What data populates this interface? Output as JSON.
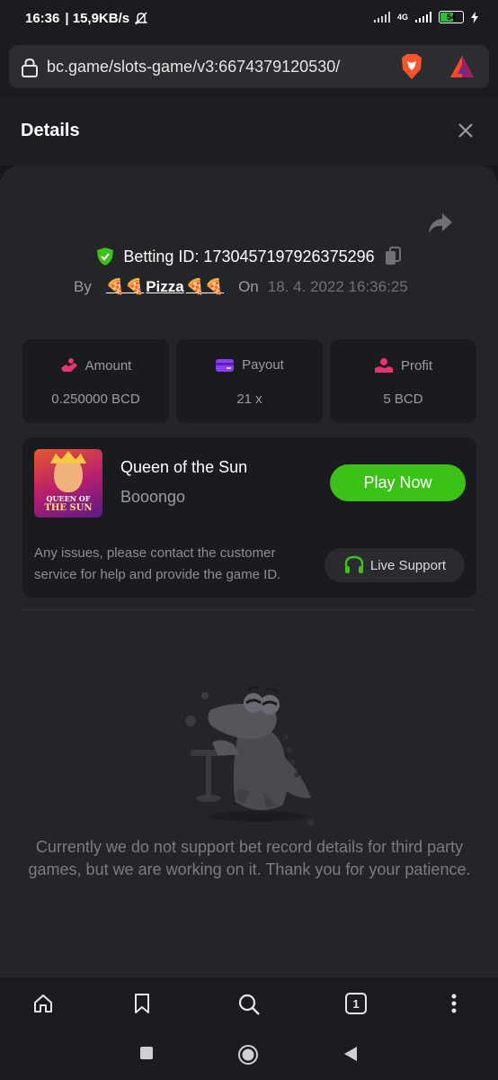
{
  "status_bar": {
    "time": "16:36",
    "speed": "| 15,9KB/s",
    "network": "4G",
    "battery": "54"
  },
  "browser": {
    "url": "bc.game/slots-game/v3:6674379120530/",
    "tab_count": "1"
  },
  "modal": {
    "title": "Details",
    "betting_id_label": "Betting ID: 1730457197926375296",
    "by_label": "By",
    "user_name": "Pizza",
    "user_emoji_left": "🍕🍕",
    "user_emoji_right": "🍕🍕",
    "on_label": "On",
    "date": "18. 4. 2022 16:36:25",
    "stats": [
      {
        "label": "Amount",
        "value": "0.250000 BCD",
        "icon": "amount-icon",
        "color": "#e8356d"
      },
      {
        "label": "Payout",
        "value": "21 x",
        "icon": "card-icon",
        "color": "#8b3ff2"
      },
      {
        "label": "Profit",
        "value": "5 BCD",
        "icon": "profit-icon",
        "color": "#e8356d"
      }
    ],
    "game": {
      "name": "Queen of the Sun",
      "provider": "Booongo",
      "thumb_line1": "QUEEN OF",
      "thumb_line2": "THE SUN",
      "play_label": "Play Now"
    },
    "issues_text": "Any issues, please contact the customer service for help and provide the game ID.",
    "support_label": "Live Support",
    "notice": "Currently we do not support bet record details for third party games, but we are working on it. Thank you for your patience."
  },
  "colors": {
    "accent_green": "#3bc117",
    "verified_green": "#3bc117"
  }
}
